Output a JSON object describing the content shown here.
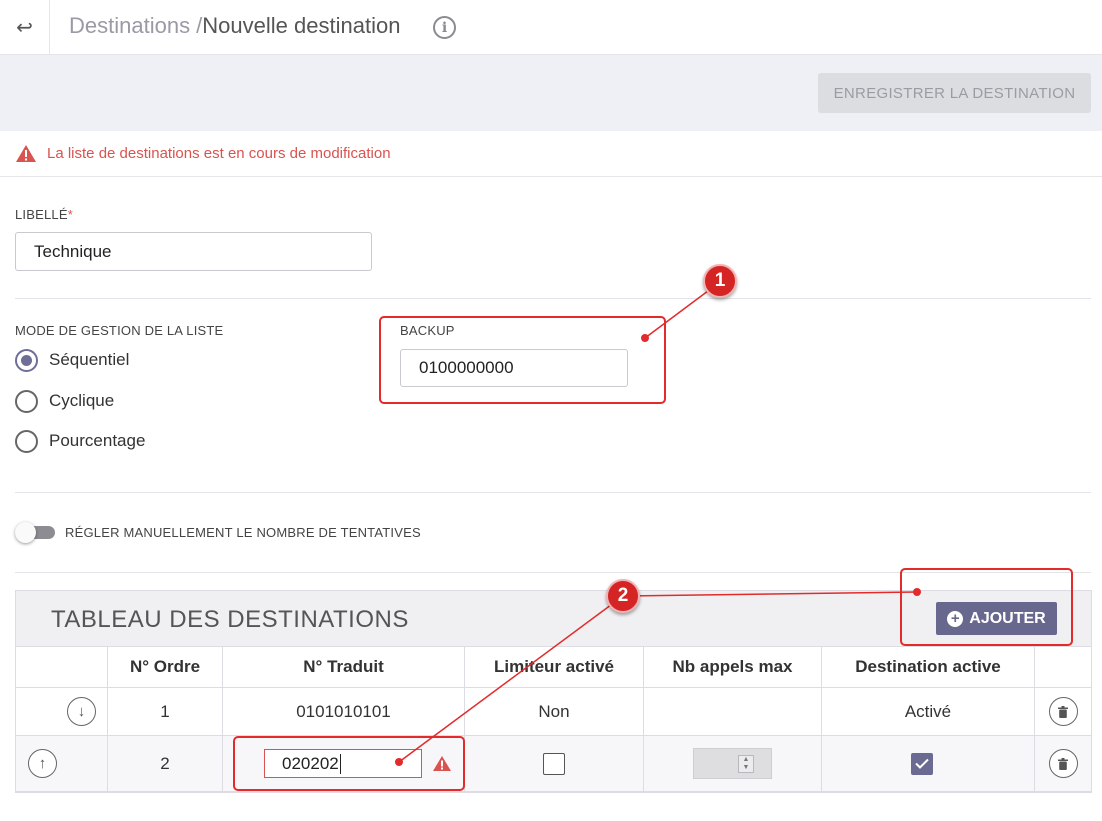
{
  "header": {
    "back_icon": "arrow-return-left",
    "breadcrumb_parent": "Destinations /",
    "breadcrumb_current": "Nouvelle destination",
    "info_icon": "i"
  },
  "toolbar": {
    "save_label": "ENREGISTRER LA DESTINATION"
  },
  "warning": {
    "text": "La liste de destinations est en cours de modification",
    "color": "#d9534f"
  },
  "form": {
    "libelle_label": "LIBELLÉ",
    "libelle_required": "*",
    "libelle_value": "Technique",
    "mode_label": "MODE DE GESTION DE LA LISTE",
    "modes": [
      {
        "label": "Séquentiel",
        "selected": true
      },
      {
        "label": "Cyclique",
        "selected": false
      },
      {
        "label": "Pourcentage",
        "selected": false
      }
    ],
    "backup_label": "BACKUP",
    "backup_value": "0100000000",
    "toggle_label": "RÉGLER MANUELLEMENT LE NOMBRE DE TENTATIVES",
    "toggle_on": false
  },
  "table": {
    "title": "TABLEAU DES DESTINATIONS",
    "add_label": "AJOUTER",
    "columns": [
      "",
      "N° Ordre",
      "N° Traduit",
      "Limiteur activé",
      "Nb appels max",
      "Destination active",
      ""
    ],
    "rows": [
      {
        "move": "down",
        "ordre": "1",
        "traduit": "0101010101",
        "limiteur": "Non",
        "nb_appels": "",
        "active": "Activé"
      },
      {
        "move": "up",
        "ordre": "2",
        "traduit": "020202",
        "limiteur_checked": false,
        "active_checked": true
      }
    ]
  },
  "annotations": {
    "badge_1": "1",
    "badge_2": "2",
    "color": "#e22b2b"
  },
  "accent_color": "#68688e"
}
